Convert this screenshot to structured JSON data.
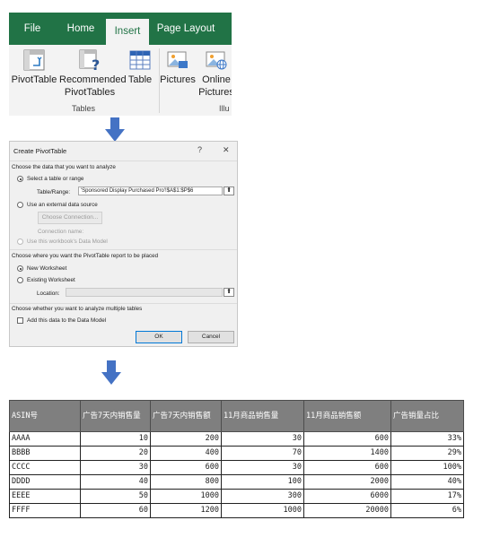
{
  "ribbon": {
    "tabs": [
      "File",
      "Home",
      "Insert",
      "Page Layout"
    ],
    "active_tab": "Insert",
    "buttons": [
      {
        "line1": "PivotTable",
        "line2": ""
      },
      {
        "line1": "Recommended",
        "line2": "PivotTables"
      },
      {
        "line1": "Table",
        "line2": ""
      },
      {
        "line1": "Pictures",
        "line2": ""
      },
      {
        "line1": "Online",
        "line2": "Pictures"
      }
    ],
    "group_tables": "Tables",
    "group_illustrations_partial": "Illu",
    "accent_color": "#217346"
  },
  "dialog": {
    "title": "Create PivotTable",
    "help_glyph": "?",
    "close_glyph": "✕",
    "section1": "Choose the data that you want to analyze",
    "opt_select_table": "Select a table or range",
    "table_range_label": "Table/Range:",
    "table_range_value": "'Sponsored Display Purchased Pro'!$A$1:$P$6",
    "opt_external": "Use an external data source",
    "choose_connection": "Choose Connection...",
    "connection_name": "Connection name:",
    "opt_data_model": "Use this workbook's Data Model",
    "section2": "Choose where you want the PivotTable report to be placed",
    "opt_new_ws": "New Worksheet",
    "opt_existing_ws": "Existing Worksheet",
    "location_label": "Location:",
    "location_value": "",
    "section3": "Choose whether you want to analyze multiple tables",
    "add_data_model": "Add this data to the Data Model",
    "ok": "OK",
    "cancel": "Cancel"
  },
  "table": {
    "headers": [
      "ASIN号",
      "广告7天内销售量",
      "广告7天内销售额",
      "11月商品销售量",
      "11月商品销售额",
      "广告销量占比"
    ],
    "rows": [
      [
        "AAAA",
        "10",
        "200",
        "30",
        "600",
        "33%"
      ],
      [
        "BBBB",
        "20",
        "400",
        "70",
        "1400",
        "29%"
      ],
      [
        "CCCC",
        "30",
        "600",
        "30",
        "600",
        "100%"
      ],
      [
        "DDDD",
        "40",
        "800",
        "100",
        "2000",
        "40%"
      ],
      [
        "EEEE",
        "50",
        "1000",
        "300",
        "6000",
        "17%"
      ],
      [
        "FFFF",
        "60",
        "1200",
        "1000",
        "20000",
        "6%"
      ]
    ]
  },
  "arrow_color": "#4472c4"
}
